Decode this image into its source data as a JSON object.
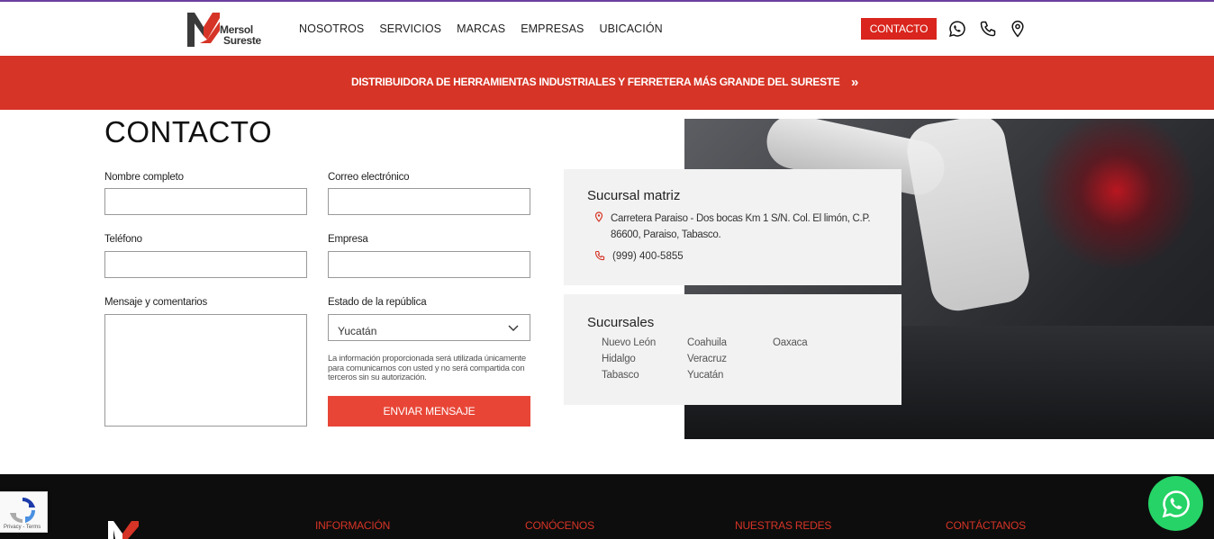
{
  "header": {
    "logo_text_line1": "Mersol",
    "logo_text_line2": "Sureste",
    "nav": [
      "NOSOTROS",
      "SERVICIOS",
      "MARCAS",
      "EMPRESAS",
      "UBICACIÓN"
    ],
    "contact_button": "CONTACTO",
    "icons": [
      "whatsapp-icon",
      "phone-icon",
      "location-pin-icon"
    ]
  },
  "banner": {
    "text": "DISTRIBUIDORA DE HERRAMIENTAS INDUSTRIALES Y FERRETERA MÁS GRANDE DEL SURESTE",
    "arrow": "»"
  },
  "contact": {
    "title": "CONTACTO",
    "fields": {
      "name_label": "Nombre completo",
      "email_label": "Correo electrónico",
      "phone_label": "Teléfono",
      "company_label": "Empresa",
      "message_label": "Mensaje y comentarios",
      "state_label": "Estado de la república",
      "state_value": "Yucatán"
    },
    "disclaimer": "La información proporcionada será utilizada únicamente para comunicarnos con usted y no será compartida con terceros sin su autorización.",
    "submit": "ENVIAR MENSAJE"
  },
  "branches": {
    "main_title": "Sucursal matriz",
    "address": "Carretera Paraiso - Dos bocas Km 1 S/N. Col. El limón, C.P. 86600, Paraiso, Tabasco.",
    "phone": "(999) 400-5855",
    "others_title": "Sucursales",
    "states": [
      "Nuevo León",
      "Coahuila",
      "Oaxaca",
      "Hidalgo",
      "Veracruz",
      "",
      "Tabasco",
      "Yucatán",
      ""
    ]
  },
  "footer": {
    "headings": [
      "INFORMACIÓN",
      "CONÓCENOS",
      "NUESTRAS REDES",
      "CONTÁCTANOS"
    ]
  },
  "recaptcha": {
    "text": "Privacy - Terms"
  },
  "colors": {
    "brand_red": "#d63426",
    "whatsapp_green": "#25d366",
    "footer_bg": "#0d0d0d"
  }
}
